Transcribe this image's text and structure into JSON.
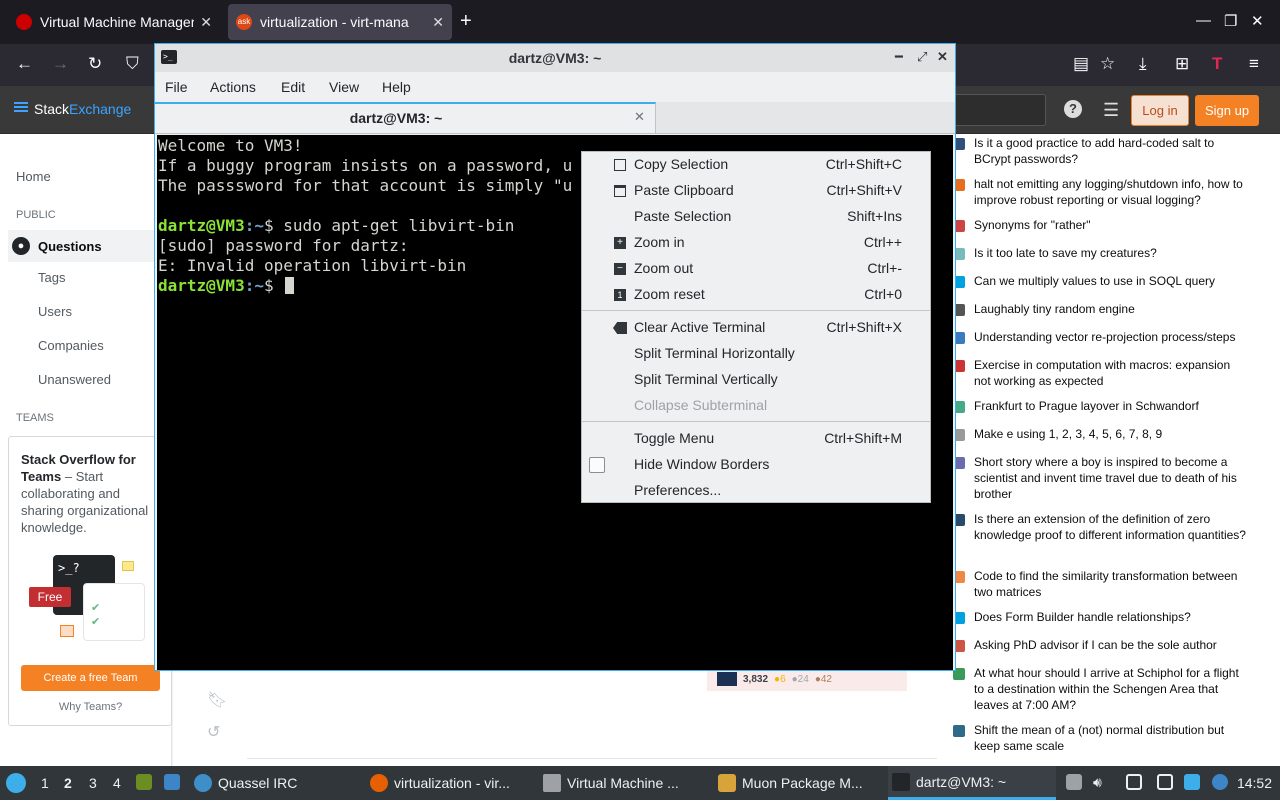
{
  "browser": {
    "tabs": [
      {
        "title": "Virtual Machine Manager",
        "active": false
      },
      {
        "title": "virtualization - virt-mana",
        "favicon": "ask",
        "active": true
      }
    ],
    "new_tab": "+",
    "win_min": "—",
    "win_max": "❐",
    "win_close": "✕"
  },
  "stackexchange": {
    "logo_a": "Stack",
    "logo_b": "Exchange",
    "help": "?",
    "login": "Log in",
    "signup": "Sign up",
    "left_nav": {
      "home": "Home",
      "public": "PUBLIC",
      "questions": "Questions",
      "tags": "Tags",
      "users": "Users",
      "companies": "Companies",
      "unanswered": "Unanswered",
      "teams": "TEAMS"
    },
    "teams_box": {
      "title_bold": "Stack Overflow for Teams",
      "title_rest": " – Start collaborating and sharing organizational knowledge.",
      "free": "Free",
      "prompt": ">_?",
      "cta": "Create a free Team",
      "why": "Why Teams?"
    },
    "user_card": {
      "rep": "3,832",
      "gold": "●6",
      "silver": "●24",
      "bronze": "●42"
    },
    "hot_questions": [
      "Is it a good practice to add hard-coded salt to BCrypt passwords?",
      "halt not emitting any logging/shutdown info, how to improve robust reporting or visual logging?",
      "Synonyms for \"rather\"",
      "Is it too late to save my creatures?",
      "Can we multiply values to use in SOQL query",
      "Laughably tiny random engine",
      "Understanding vector re-projection process/steps",
      "Exercise in computation with macros: expansion not working as expected",
      "Frankfurt to Prague layover in Schwandorf",
      "Make e using 1, 2, 3, 4, 5, 6, 7, 8, 9",
      "Short story where a boy is inspired to become a scientist and invent time travel due to death of his brother",
      "Is there an extension of the definition of zero knowledge proof to different information quantities?",
      "Code to find the similarity transformation between two matrices",
      "Does Form Builder handle relationships?",
      "Asking PhD advisor if I can be the sole author",
      "At what hour should I arrive at Schiphol for a flight to a destination within the Schengen Area that leaves at 7:00 AM?",
      "Shift the mean of a (not) normal distribution but keep same scale"
    ]
  },
  "terminal": {
    "window_title": "dartz@VM3: ~",
    "icon_text": ">_",
    "menus": [
      "File",
      "Actions",
      "Edit",
      "View",
      "Help"
    ],
    "tab_label": "dartz@VM3: ~",
    "tab_close": "✕",
    "lines": {
      "l1": "Welcome to VM3!",
      "l2": "If a buggy program insists on a password, u",
      "l3": "The passsword for that account is simply \"u",
      "p1_user": "dartz@VM3",
      "p1_dir": ":~",
      "p1_cmd": "$ sudo apt-get libvirt-bin",
      "l5": "[sudo] password for dartz:",
      "l6": "E: Invalid operation libvirt-bin",
      "p2_user": "dartz@VM3",
      "p2_dir": ":~",
      "p2_cmd": "$ "
    }
  },
  "context_menu": {
    "items": [
      {
        "label": "Copy Selection",
        "shortcut": "Ctrl+Shift+C"
      },
      {
        "label": "Paste Clipboard",
        "shortcut": "Ctrl+Shift+V"
      },
      {
        "label": "Paste Selection",
        "shortcut": "Shift+Ins"
      },
      {
        "label": "Zoom in",
        "shortcut": "Ctrl++"
      },
      {
        "label": "Zoom out",
        "shortcut": "Ctrl+-"
      },
      {
        "label": "Zoom reset",
        "shortcut": "Ctrl+0"
      },
      {
        "label": "Clear Active Terminal",
        "shortcut": "Ctrl+Shift+X"
      },
      {
        "label": "Split Terminal Horizontally",
        "shortcut": ""
      },
      {
        "label": "Split Terminal Vertically",
        "shortcut": ""
      },
      {
        "label": "Collapse Subterminal",
        "shortcut": "",
        "disabled": true
      },
      {
        "label": "Toggle Menu",
        "shortcut": "Ctrl+Shift+M"
      },
      {
        "label": "Hide Window Borders",
        "shortcut": "",
        "checked": false
      },
      {
        "label": "Preferences...",
        "shortcut": ""
      }
    ]
  },
  "taskbar": {
    "desktops": [
      "1",
      "2",
      "3",
      "4"
    ],
    "active_desktop": "2",
    "tasks": [
      {
        "label": "Quassel IRC"
      },
      {
        "label": "virtualization - vir..."
      },
      {
        "label": "Virtual Machine ..."
      },
      {
        "label": "Muon Package M..."
      },
      {
        "label": "dartz@VM3: ~",
        "active": true
      }
    ],
    "clock": "14:52"
  },
  "colors": {
    "accent": "#3daee9",
    "se_orange": "#f48225",
    "terminal_green": "#8ae234",
    "terminal_blue": "#729fcf"
  }
}
